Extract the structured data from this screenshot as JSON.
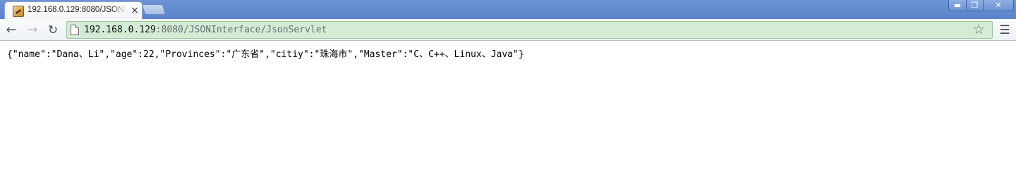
{
  "tab": {
    "title": "192.168.0.129:8080/JSONInterface/JsonServlet",
    "close_glyph": "×",
    "favicon": "page-favicon-icon"
  },
  "window_controls": {
    "minimize": "▬",
    "maximize": "❐",
    "close": "✕"
  },
  "toolbar": {
    "back_glyph": "←",
    "forward_glyph": "→",
    "reload_glyph": "↻",
    "url_host": "192.168.0.129",
    "url_rest": ":8080/JSONInterface/JsonServlet",
    "star_glyph": "☆",
    "menu_glyph": "☰"
  },
  "content": {
    "body_text": "{\"name\":\"Dana、Li\",\"age\":22,\"Provinces\":\"广东省\",\"citiy\":\"珠海市\",\"Master\":\"C、C++、Linux、Java\"}"
  },
  "colors": {
    "titlebar": "#5a83cb",
    "omnibox_bg": "#d4ecd6",
    "omnibox_border": "#9cc2a0"
  }
}
